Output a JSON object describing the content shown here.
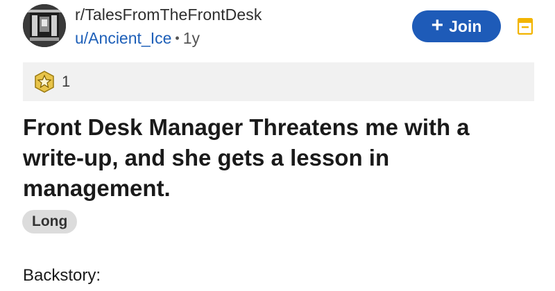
{
  "post": {
    "subreddit": "r/TalesFromTheFrontDesk",
    "author": "u/Ancient_Ice",
    "separator": "•",
    "age": "1y",
    "join_label": "Join",
    "join_plus": "+",
    "award_count": "1",
    "title": "Front Desk Manager Threatens me with a write-up, and she gets a lesson in management.",
    "flair": "Long",
    "body_start": "Backstory:"
  },
  "colors": {
    "accent": "#1e5bb8",
    "link": "#1d5fb8",
    "save_icon": "#f2b400",
    "award_badge": "#e8c44a",
    "awards_bg": "#f1f1f1",
    "flair_bg": "#dcdcdc"
  },
  "icons": {
    "avatar": "subreddit-avatar",
    "award": "award-badge-icon",
    "save": "save-icon"
  }
}
